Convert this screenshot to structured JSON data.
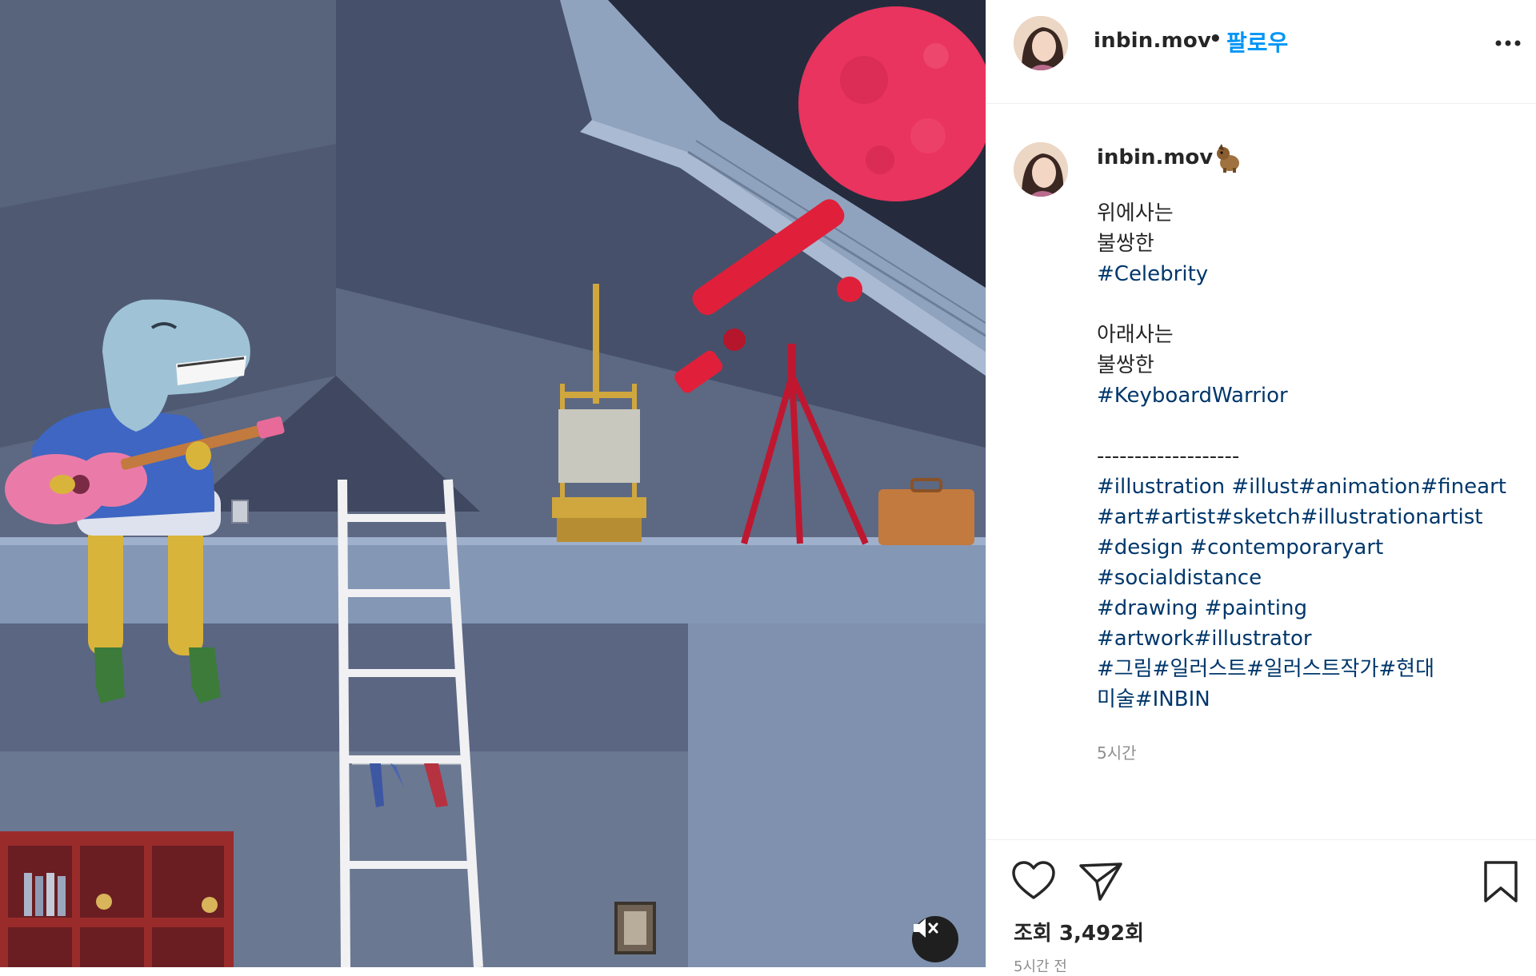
{
  "post": {
    "username": "inbin.mov",
    "separator": "•",
    "follow_label": "팔로우",
    "more_icon": "more-horizontal-icon"
  },
  "caption": {
    "username": "inbin.mov",
    "emoji": "dog-emoji",
    "lines": [
      {
        "text": "위에사는",
        "type": "text"
      },
      {
        "text": "불쌍한",
        "type": "text"
      },
      {
        "text": "#Celebrity",
        "type": "hashtag"
      },
      {
        "text": "",
        "type": "gap"
      },
      {
        "text": "아래사는",
        "type": "text"
      },
      {
        "text": "불쌍한",
        "type": "text"
      },
      {
        "text": "#KeyboardWarrior",
        "type": "hashtag"
      },
      {
        "text": "",
        "type": "gap"
      },
      {
        "text": "-------------------",
        "type": "text"
      },
      {
        "text": "#illustration #illust#animation#fineart",
        "type": "hashtag"
      },
      {
        "text": "#art#artist#sketch#illustrationartist",
        "type": "hashtag"
      },
      {
        "text": "#design #contemporaryart",
        "type": "hashtag"
      },
      {
        "text": "#socialdistance",
        "type": "hashtag"
      },
      {
        "text": "#drawing #painting",
        "type": "hashtag"
      },
      {
        "text": "#artwork#illustrator",
        "type": "hashtag"
      },
      {
        "text": "#그림#일러스트#일러스트작가#현대",
        "type": "hashtag"
      },
      {
        "text": "미술#INBIN",
        "type": "hashtag"
      }
    ],
    "relative_time": "5시간"
  },
  "actions": {
    "like_icon": "heart-icon",
    "share_icon": "paper-plane-icon",
    "save_icon": "bookmark-icon",
    "views": "조회 3,492회",
    "time_bottom": "5시간 전"
  },
  "media": {
    "mute_icon": "speaker-muted-icon"
  },
  "colors": {
    "link_blue": "#0095f6",
    "hashtag": "#00376b",
    "muted_text": "#8e8e8e",
    "moon": "#e8345e",
    "telescope": "#e0203a"
  }
}
